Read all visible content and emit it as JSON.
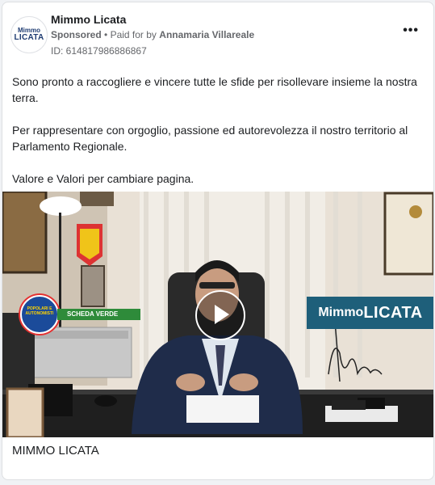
{
  "ad": {
    "page_name": "Mimmo Licata",
    "avatar_line1": "Mimmo",
    "avatar_line2": "LICATA",
    "sponsored_label": "Sponsored",
    "paid_for_prefix": "Paid for by",
    "payer": "Annamaria Villareale",
    "ad_id": "ID: 614817986886867",
    "more_icon": "more-horizontal-icon",
    "body_paragraphs": [
      "Sono pronto a raccogliere e vincere tutte le sfide per risollevare insieme la nostra terra.",
      "Per rappresentare con orgoglio, passione ed autorevolezza il nostro territorio al Parlamento Regionale.",
      "Valore e Valori per cambiare pagina."
    ],
    "video": {
      "badge_text": "SCHEDA VERDE",
      "logo_text": "POPOLARI E AUTONOMISTI",
      "watermark_first": "Mimmo",
      "watermark_last": "LICATA",
      "play_icon": "play-icon"
    },
    "link_title": "MIMMO LICATA"
  },
  "colors": {
    "text": "#1c1e21",
    "secondary": "#65676b",
    "watermark_bg": "#1e5f7a",
    "badge_green": "#2e8b3a"
  }
}
